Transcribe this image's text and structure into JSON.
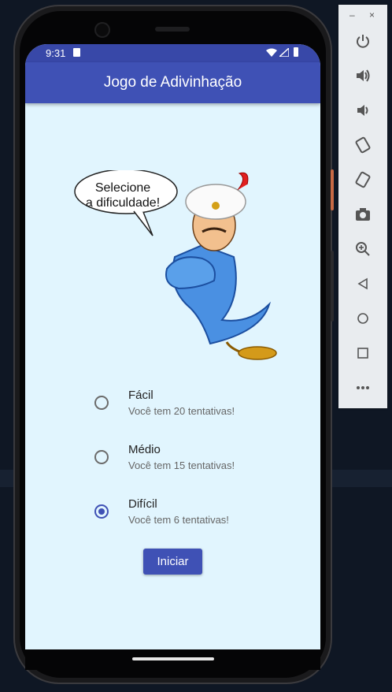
{
  "status_bar": {
    "time": "9:31"
  },
  "app_bar": {
    "title": "Jogo de Adivinhação"
  },
  "speech_bubble": {
    "line1": "Selecione",
    "line2": "a dificuldade!"
  },
  "difficulty_options": [
    {
      "title": "Fácil",
      "subtitle": "Você tem 20 tentativas!",
      "selected": false
    },
    {
      "title": "Médio",
      "subtitle": "Você tem 15 tentativas!",
      "selected": false
    },
    {
      "title": "Difícil",
      "subtitle": "Você tem 6 tentativas!",
      "selected": true
    }
  ],
  "start_button": {
    "label": "Iniciar"
  },
  "emulator_panel": {
    "minimize": "–",
    "close": "×",
    "tools": [
      "power-icon",
      "volume-up-icon",
      "volume-down-icon",
      "rotate-left-icon",
      "rotate-right-icon",
      "camera-icon",
      "zoom-icon",
      "back-icon",
      "home-icon",
      "overview-icon",
      "more-icon"
    ]
  },
  "colors": {
    "primary": "#3f51b5",
    "status_bar": "#3848a8",
    "screen_bg": "#e1f5fe"
  }
}
